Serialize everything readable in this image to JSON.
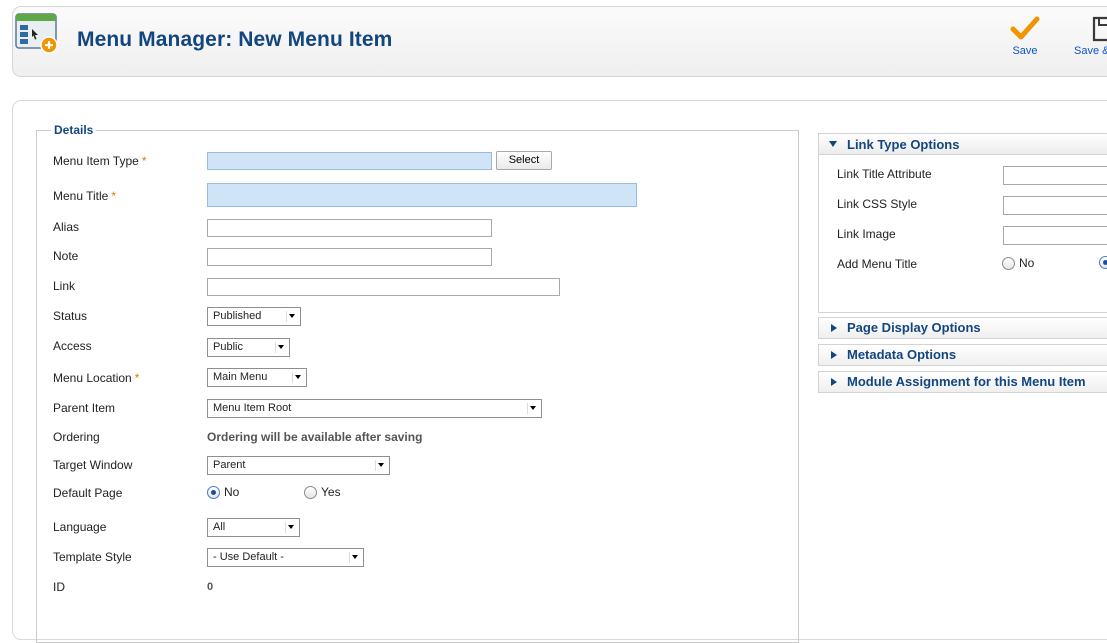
{
  "header": {
    "title": "Menu Manager: New Menu Item",
    "save_label": "Save",
    "save_close_label": "Save &"
  },
  "details": {
    "legend": "Details",
    "required_mark": "*",
    "menu_item_type": {
      "label": "Menu Item Type",
      "value": "",
      "select_label": "Select"
    },
    "menu_title": {
      "label": "Menu Title",
      "value": ""
    },
    "alias": {
      "label": "Alias",
      "value": ""
    },
    "note": {
      "label": "Note",
      "value": ""
    },
    "link": {
      "label": "Link",
      "value": ""
    },
    "status": {
      "label": "Status",
      "value": "Published"
    },
    "access": {
      "label": "Access",
      "value": "Public"
    },
    "menu_location": {
      "label": "Menu Location",
      "value": "Main Menu"
    },
    "parent_item": {
      "label": "Parent Item",
      "value": "Menu Item Root"
    },
    "ordering": {
      "label": "Ordering",
      "value": "Ordering will be available after saving"
    },
    "target_window": {
      "label": "Target Window",
      "value": "Parent"
    },
    "default_page": {
      "label": "Default Page",
      "no": "No",
      "yes": "Yes",
      "selected": "No"
    },
    "language": {
      "label": "Language",
      "value": "All"
    },
    "template_style": {
      "label": "Template Style",
      "value": "- Use Default -"
    },
    "id": {
      "label": "ID",
      "value": "0"
    }
  },
  "sidebar": {
    "link_type_options": {
      "title": "Link Type Options",
      "link_title_attribute": "Link Title Attribute",
      "link_css_style": "Link CSS Style",
      "link_image": "Link Image",
      "add_menu_title": "Add Menu Title",
      "add_menu_title_no": "No",
      "add_menu_title_selected": "Yes"
    },
    "page_display_options": "Page Display Options",
    "metadata_options": "Metadata Options",
    "module_assignment": "Module Assignment for this Menu Item"
  },
  "colors": {
    "title_blue": "#13467f",
    "required_orange": "#e07b00",
    "required_field_bg": "#cfe5f7",
    "save_check": "#f29400"
  }
}
